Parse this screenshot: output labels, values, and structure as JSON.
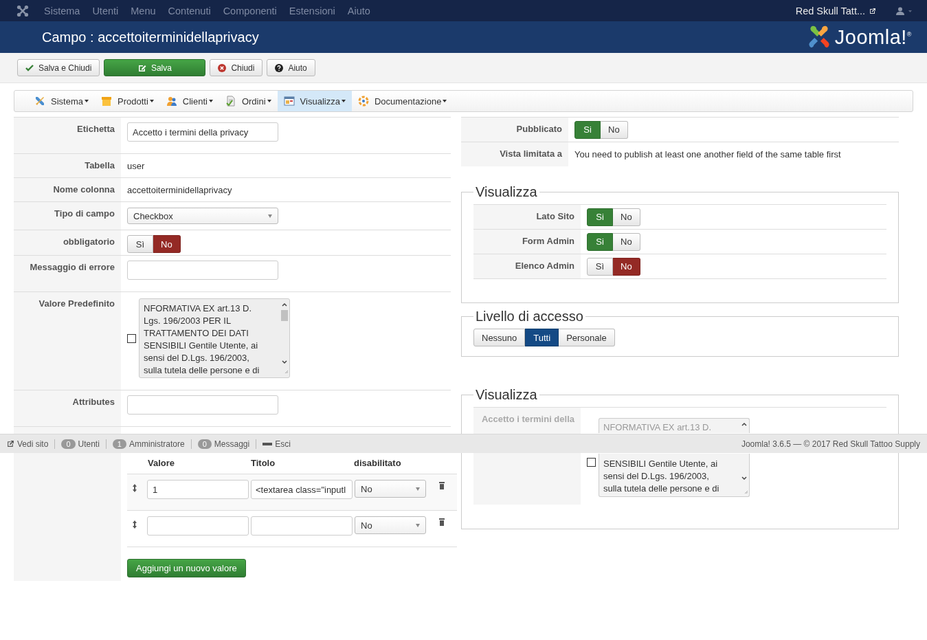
{
  "topnav": {
    "menu": [
      "Sistema",
      "Utenti",
      "Menu",
      "Contenuti",
      "Componenti",
      "Estensioni",
      "Aiuto"
    ],
    "site": "Red Skull Tatt..."
  },
  "header": {
    "title": "Campo : accettoiterminidellaprivacy",
    "logo_text": "Joomla!$^{®}$"
  },
  "toolbar": [
    {
      "kind": "save-close",
      "label": "Salva e Chiudi"
    },
    {
      "kind": "save",
      "label": "Salva"
    },
    {
      "kind": "close",
      "label": "Chiudi"
    },
    {
      "kind": "help",
      "label": "Aiuto"
    }
  ],
  "component_menu": [
    {
      "kind": "tools",
      "label": "Sistema",
      "selected": false
    },
    {
      "kind": "box",
      "label": "Prodotti",
      "selected": false
    },
    {
      "kind": "users",
      "label": "Clienti",
      "selected": false
    },
    {
      "kind": "document",
      "label": "Ordini",
      "selected": false
    },
    {
      "kind": "window",
      "label": "Visualizza",
      "selected": true
    },
    {
      "kind": "help",
      "label": "Documentazione",
      "selected": false
    }
  ],
  "form": {
    "rows": [
      {
        "kind": "input",
        "label": "Etichetta",
        "value": "Accetto i termini della privacy"
      },
      {
        "kind": "text",
        "label": "Tabella",
        "value": "user"
      },
      {
        "kind": "text",
        "label": "Nome colonna",
        "value": "accettoiterminidellaprivacy"
      },
      {
        "kind": "select",
        "label": "Tipo di campo",
        "value": "Checkbox"
      },
      {
        "kind": "toggle",
        "label": "obbligatorio",
        "options": [
          {
            "label": "Sì",
            "selected": false
          },
          {
            "label": "No",
            "selected": true
          }
        ]
      },
      {
        "kind": "input",
        "label": "Messaggio di errore"
      },
      {
        "kind": "textarea",
        "label": "Valore Predefinito",
        "checked": false,
        "lines": [
          "NFORMATIVA  EX art.13 D.",
          "Lgs. 196/2003 PER IL",
          "TRATTAMENTO DEI DATI",
          "SENSIBILI  Gentile Utente, ai",
          "sensi del D.Lgs. 196/2003,",
          "sulla tutela delle persone e di"
        ]
      },
      {
        "kind": "input",
        "label": "Attributes"
      },
      {
        "kind": "values"
      }
    ]
  },
  "values_table": {
    "columns": [
      "Valore",
      "Titolo",
      "disabilitato"
    ],
    "rows": [
      {
        "value": "1",
        "title": "<textarea class=\"inputl",
        "disabled": "No"
      },
      {
        "disabled": "No"
      }
    ],
    "add_button": "Aggiungi un nuovo valore"
  },
  "side": {
    "rows": [
      {
        "kind": "toggle",
        "label": "Pubblicato",
        "options": [
          {
            "label": "Si",
            "selected": true
          },
          {
            "label": "No",
            "selected": false
          }
        ]
      },
      {
        "kind": "text",
        "label": "Vista limitata a",
        "value": "You need to publish at least one another field of the same table first"
      }
    ]
  },
  "fieldsets": [
    {
      "kind": "toggles",
      "legend": "Visualizza",
      "rows": [
        {
          "label": "Lato Sito",
          "options": [
            {
              "label": "Si",
              "selected": true
            },
            {
              "label": "No",
              "selected": false
            }
          ]
        },
        {
          "label": "Form Admin",
          "options": [
            {
              "label": "Si",
              "selected": true
            },
            {
              "label": "No",
              "selected": false
            }
          ]
        },
        {
          "label": "Elenco Admin",
          "options": [
            {
              "label": "Sì",
              "selected": false
            },
            {
              "label": "No",
              "selected": true
            }
          ]
        }
      ]
    },
    {
      "kind": "segmented",
      "legend": "Livello di accesso",
      "options": [
        {
          "label": "Nessuno",
          "selected": false
        },
        {
          "label": "Tutti",
          "selected": true
        },
        {
          "label": "Personale",
          "selected": false
        }
      ]
    },
    {
      "kind": "preview",
      "legend": "Visualizza",
      "rows": [
        {
          "label": "Accetto i termini della",
          "checked": false,
          "lines_top": [
            "NFORMATIVA  EX art.13 D."
          ],
          "lines_bottom": [
            "SENSIBILI  Gentile Utente, ai",
            "sensi del D.Lgs. 196/2003,",
            "sulla tutela delle persone e di"
          ]
        }
      ]
    }
  ],
  "status_bar": {
    "items": [
      {
        "kind": "link",
        "label": "Vedi sito"
      },
      {
        "kind": "count",
        "count": "0",
        "label": "Utenti"
      },
      {
        "kind": "count",
        "count": "1",
        "label": "Amministratore"
      },
      {
        "kind": "count",
        "count": "0",
        "label": "Messaggi"
      },
      {
        "kind": "logout",
        "label": "Esci"
      }
    ],
    "footer": "Joomla! 3.6.5 — © 2017 Red Skull Tattoo Supply"
  }
}
